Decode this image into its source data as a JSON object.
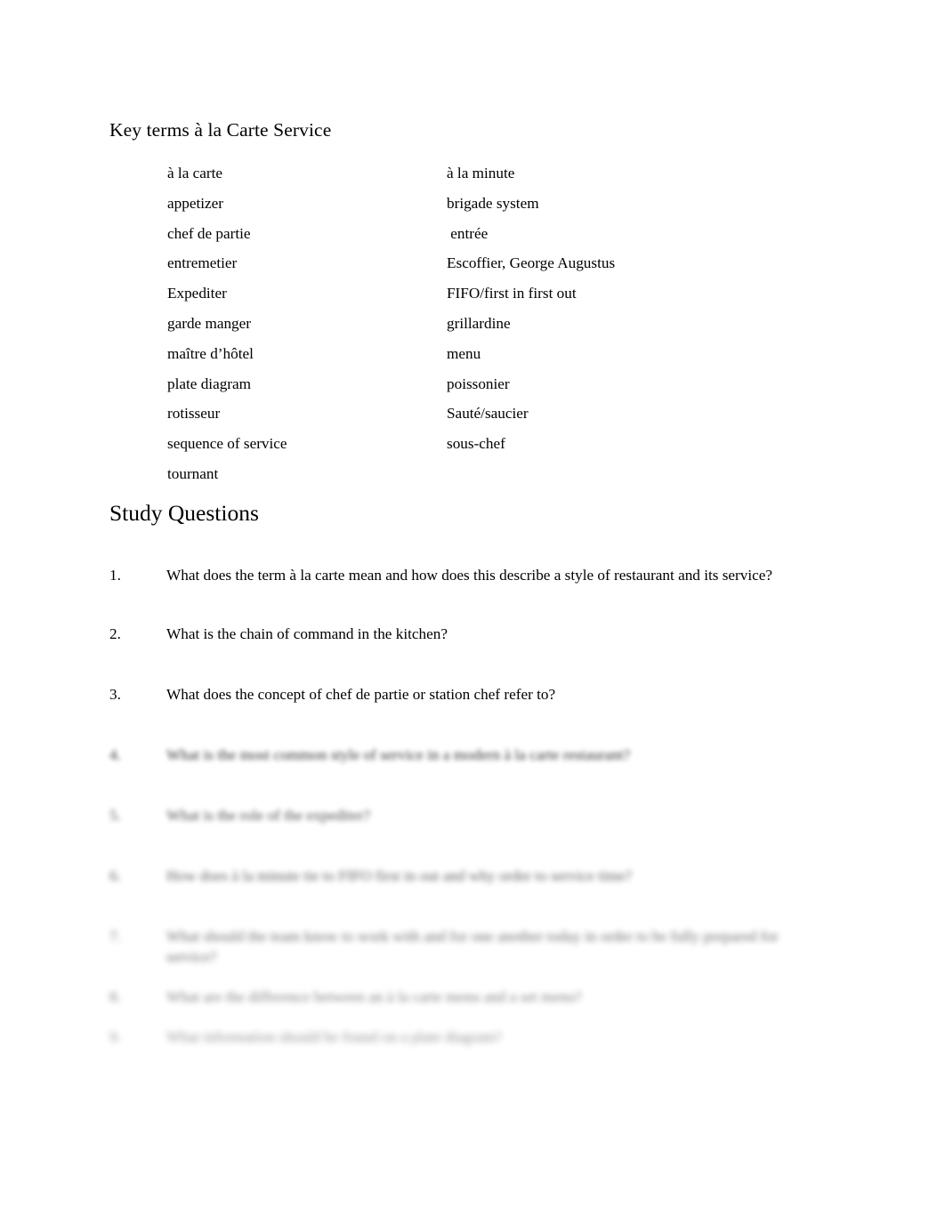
{
  "document": {
    "title": "Key terms à la Carte Service",
    "key_terms": [
      {
        "left": "à la carte",
        "right": "à la minute"
      },
      {
        "left": "appetizer",
        "right": "brigade system"
      },
      {
        "left": "chef de partie",
        "right": " entrée"
      },
      {
        "left": "entremetier",
        "right": "Escoffier, George Augustus"
      },
      {
        "left": "Expediter",
        "right": "FIFO/first in first out"
      },
      {
        "left": "garde manger",
        "right": "grillardine"
      },
      {
        "left": "maître d’hôtel",
        "right": "menu"
      },
      {
        "left": "plate diagram",
        "right": "poissonier"
      },
      {
        "left": "rotisseur",
        "right": "Sauté/saucier"
      },
      {
        "left": "sequence of service",
        "right": "sous-chef"
      },
      {
        "left": "tournant",
        "right": ""
      }
    ],
    "section_title": "Study Questions",
    "questions": [
      {
        "number": "1.",
        "text": "What does the term à la carte mean and how does this describe a style of restaurant and its service?"
      },
      {
        "number": "2.",
        "text": "What is the chain of command in the kitchen?"
      },
      {
        "number": "3.",
        "text": "What does the concept of chef de partie or station chef refer to?"
      },
      {
        "number": "4.",
        "text": "What is the most common style of service in a modern à la carte restaurant?"
      },
      {
        "number": "5.",
        "text": "What is the role of the expediter?"
      },
      {
        "number": "6.",
        "text": "How does à la minute tie to FIFO first in out and why order to service time?"
      },
      {
        "number": "7.",
        "text": "What should the team know to work with and for one another today in order to be fully prepared for service?"
      },
      {
        "number": "8.",
        "text": "What are the difference between an à la carte menu and a set menu?"
      },
      {
        "number": "9.",
        "text": "What information should be found on a plate diagram?"
      }
    ]
  }
}
